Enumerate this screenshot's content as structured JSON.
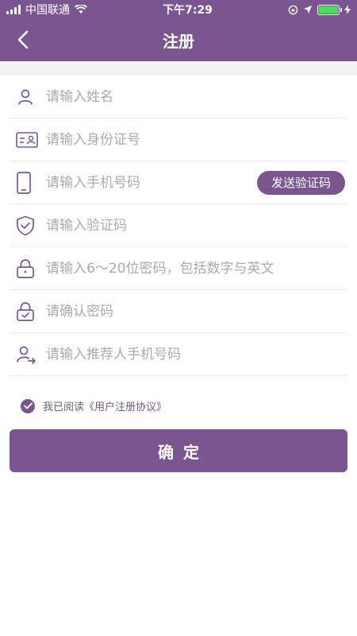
{
  "status": {
    "carrier": "中国联通",
    "time": "下午7:29"
  },
  "nav": {
    "title": "注册"
  },
  "form": {
    "name_placeholder": "请输入姓名",
    "id_placeholder": "请输入身份证号",
    "phone_placeholder": "请输入手机号码",
    "send_code_label": "发送验证码",
    "code_placeholder": "请输入验证码",
    "password_placeholder": "请输入6～20位密码，包括数字与英文",
    "confirm_placeholder": "请确认密码",
    "referrer_placeholder": "请输入推荐人手机号码"
  },
  "agreement": {
    "prefix": "我已阅读",
    "link": "《用户注册协议》",
    "checked": true
  },
  "submit": {
    "label": "确定"
  },
  "colors": {
    "accent": "#7a5590",
    "battery": "#4cd964"
  },
  "icons": [
    "user-icon",
    "id-card-icon",
    "phone-icon",
    "shield-check-icon",
    "lock-icon",
    "lock-check-icon",
    "referrer-icon",
    "back-chevron-icon",
    "checkmark-icon"
  ]
}
